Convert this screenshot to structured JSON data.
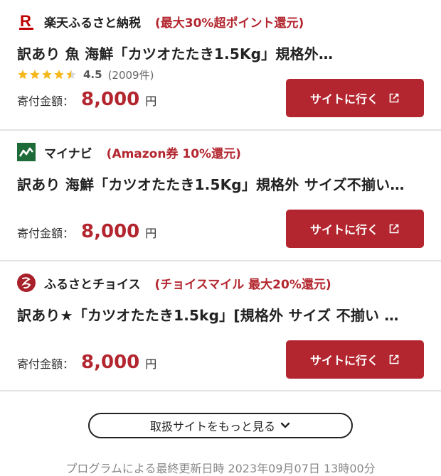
{
  "listings": [
    {
      "site_name": "楽天ふるさと納税",
      "promo": "(最大30%超ポイント還元)",
      "title": "訳あり 魚 海鮮「カツオたたき1.5Kg」規格外…",
      "rating": {
        "score": "4.5",
        "count": "(2009件)",
        "stars_value": 4.5
      },
      "price_label": "寄付金額：",
      "price_value": "8,000",
      "price_unit": "円",
      "button_label": "サイトに行く",
      "logo_icon": "rakuten-logo-icon"
    },
    {
      "site_name": "マイナビ",
      "promo": "(Amazon券 10%還元)",
      "title": "訳あり 海鮮「カツオたたき1.5Kg」規格外 サイズ不揃い…",
      "price_label": "寄付金額：",
      "price_value": "8,000",
      "price_unit": "円",
      "button_label": "サイトに行く",
      "logo_icon": "mynavi-logo-icon"
    },
    {
      "site_name": "ふるさとチョイス",
      "promo": "(チョイスマイル 最大20%還元)",
      "title": "訳あり★「カツオたたき1.5kg」[規格外 サイズ 不揃い …",
      "price_label": "寄付金額：",
      "price_value": "8,000",
      "price_unit": "円",
      "button_label": "サイトに行く",
      "logo_icon": "furusato-choice-logo-icon"
    }
  ],
  "more_button": {
    "label": "取扱サイトをもっと見る"
  },
  "footer": {
    "updated": "プログラムによる最終更新日時 2023年09月07日 13時00分"
  },
  "colors": {
    "accent": "#b3262f",
    "star": "#f5b81c",
    "mynavi": "#1e6b3a"
  }
}
